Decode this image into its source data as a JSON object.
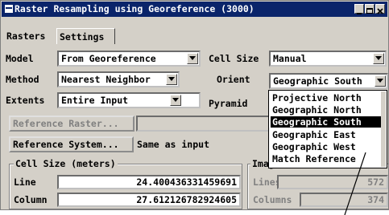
{
  "window": {
    "title": "Raster Resampling using Georeference (3000)"
  },
  "tabs": [
    {
      "label": "Rasters"
    },
    {
      "label": "Settings"
    }
  ],
  "settings": {
    "model_label": "Model",
    "model_value": "From Georeference",
    "cell_size_label": "Cell Size",
    "cell_size_value": "Manual",
    "method_label": "Method",
    "method_value": "Nearest Neighbor",
    "orient_label": "Orient",
    "orient_value": "Geographic South",
    "extents_label": "Extents",
    "extents_value": "Entire Input",
    "pyramid_label": "Pyramid",
    "reference_raster_button": "Reference Raster...",
    "reference_raster_value": "",
    "reference_system_button": "Reference System...",
    "reference_system_value": "Same as input"
  },
  "cell_size_group": {
    "title": "Cell Size (meters)",
    "line_label": "Line",
    "line_value": "24.400436331459691",
    "column_label": "Column",
    "column_value": "27.612126782924605"
  },
  "image_group": {
    "title": "Image",
    "lines_label": "Lines",
    "lines_value": "572",
    "columns_label": "Columns",
    "columns_value": "374"
  },
  "orient_dropdown": {
    "options": [
      "Projective North",
      "Geographic North",
      "Geographic South",
      "Geographic East",
      "Geographic West",
      "Match Reference"
    ],
    "selected_index": 2
  }
}
